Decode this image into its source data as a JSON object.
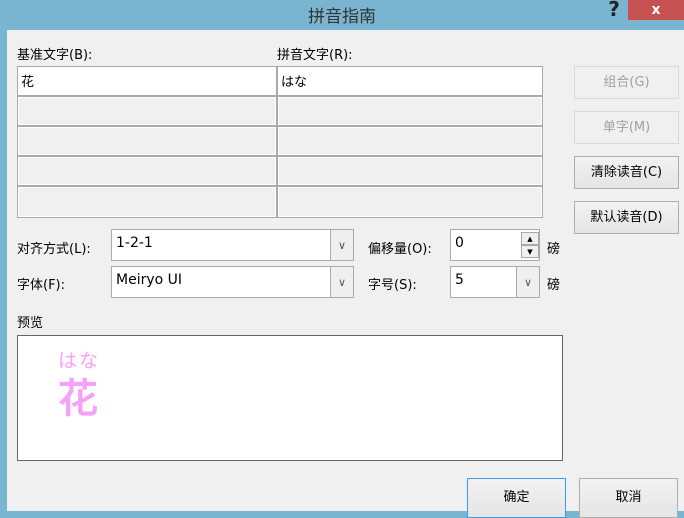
{
  "window": {
    "title": "拼音指南",
    "help_label": "?",
    "close_label": "x"
  },
  "labels": {
    "base_text": "基准文字(B):",
    "ruby_text": "拼音文字(R):",
    "alignment": "对齐方式(L):",
    "offset": "偏移量(O):",
    "font": "字体(F):",
    "size": "字号(S):",
    "offset_unit": "磅",
    "size_unit": "磅",
    "preview": "预览"
  },
  "grid": {
    "rows": [
      {
        "base": "花",
        "ruby": "はな"
      },
      {
        "base": "",
        "ruby": ""
      },
      {
        "base": "",
        "ruby": ""
      },
      {
        "base": "",
        "ruby": ""
      },
      {
        "base": "",
        "ruby": ""
      }
    ]
  },
  "buttons": {
    "group": "组合(G)",
    "mono": "单字(M)",
    "clear": "清除读音(C)",
    "default": "默认读音(D)",
    "ok": "确定",
    "cancel": "取消"
  },
  "fields": {
    "alignment": "1-2-1",
    "font": "Meiryo UI",
    "offset": "0",
    "size": "5"
  },
  "preview": {
    "ruby": "はな",
    "base": "花",
    "color": "#f7a0f7"
  }
}
